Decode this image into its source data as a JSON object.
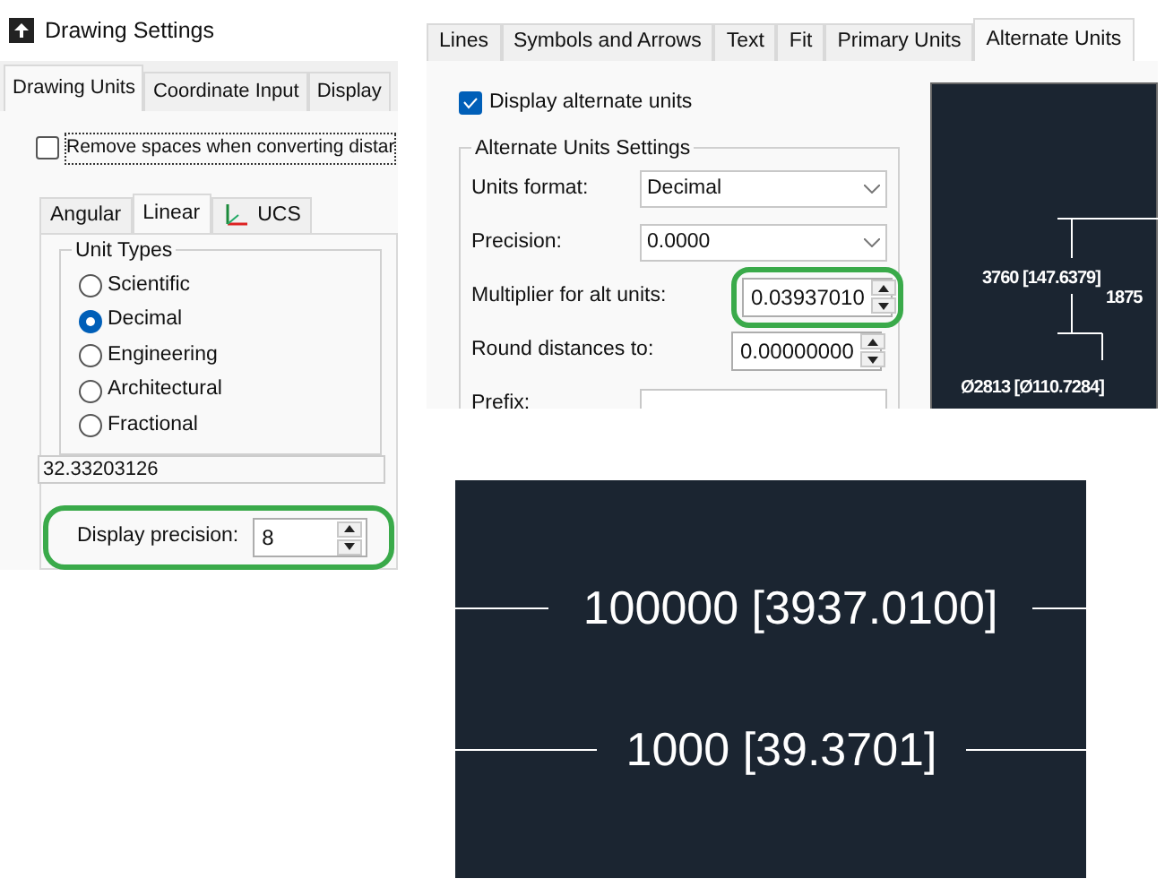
{
  "drawing_settings": {
    "window": {
      "title": "Drawing Settings"
    },
    "tabs": [
      {
        "label": "Drawing Units",
        "selected": true
      },
      {
        "label": "Coordinate Input",
        "selected": false
      },
      {
        "label": "Display",
        "selected": false
      }
    ],
    "remove_spaces": {
      "label": "Remove spaces when converting distar",
      "checked": false
    },
    "sub_tabs": [
      {
        "label": "Angular",
        "selected": false,
        "kind": "text"
      },
      {
        "label": "Linear",
        "selected": true,
        "kind": "text"
      },
      {
        "label": "UCS",
        "selected": false,
        "kind": "axes"
      }
    ],
    "unit_types": {
      "title": "Unit Types",
      "options": [
        {
          "label": "Scientific",
          "selected": false
        },
        {
          "label": "Decimal",
          "selected": true
        },
        {
          "label": "Engineering",
          "selected": false
        },
        {
          "label": "Architectural",
          "selected": false
        },
        {
          "label": "Fractional",
          "selected": false
        }
      ],
      "sample": "32.33203126"
    },
    "display_precision": {
      "label": "Display precision:",
      "value": "8"
    }
  },
  "dimension_style": {
    "tabs": [
      {
        "label": "Lines",
        "selected": false
      },
      {
        "label": "Symbols and Arrows",
        "selected": false
      },
      {
        "label": "Text",
        "selected": false
      },
      {
        "label": "Fit",
        "selected": false
      },
      {
        "label": "Primary Units",
        "selected": false
      },
      {
        "label": "Alternate Units",
        "selected": true
      }
    ],
    "display_alternate": {
      "label": "Display alternate units",
      "checked": true
    },
    "group_title": "Alternate Units Settings",
    "fields": [
      {
        "label": "Units format:",
        "value": "Decimal",
        "kind": "dropdown"
      },
      {
        "label": "Precision:",
        "value": "0.0000",
        "kind": "dropdown"
      },
      {
        "label": "Multiplier for alt units:",
        "value": "0.03937010",
        "kind": "spinner",
        "highlighted": true
      },
      {
        "label": "Round distances to:",
        "value": "0.00000000",
        "kind": "spinner",
        "highlighted": false
      },
      {
        "label": "Prefix:",
        "kind": "text"
      }
    ],
    "preview_labels": [
      "3760 [147.6379]",
      "1875",
      "Ø2813 [Ø110.7284]"
    ]
  },
  "dimension_closeup": {
    "labels": [
      "100000 [3937.0100]",
      "1000 [39.3701]"
    ]
  }
}
